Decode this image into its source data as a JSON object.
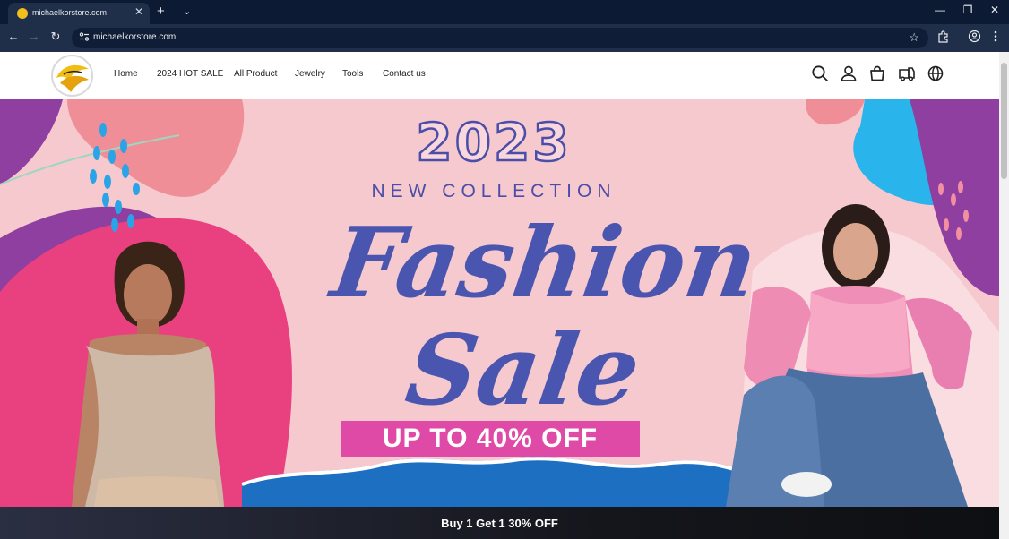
{
  "browser": {
    "tab_title": "michaelkorstore.com",
    "url": "michaelkorstore.com"
  },
  "nav": {
    "items": [
      "Home",
      "2024 HOT SALE",
      "All Product",
      "Jewelry",
      "Tools",
      "Contact us"
    ]
  },
  "hero": {
    "year": "2023",
    "collection": "NEW COLLECTION",
    "line1": "Fashion",
    "line2": "Sale",
    "badge": "UP TO 40% OFF"
  },
  "promo": {
    "text": "Buy 1 Get 1 30% OFF"
  },
  "icons": [
    "search-icon",
    "account-icon",
    "cart-icon",
    "truck-icon",
    "globe-icon"
  ],
  "colors": {
    "tabbar": "#0c1a33",
    "addrbar": "#1f2f4a",
    "hero_bg": "#f6c9cf",
    "hero_text": "#4a55b0",
    "badge": "#e04aa7",
    "promo_bar": "#15161c"
  }
}
